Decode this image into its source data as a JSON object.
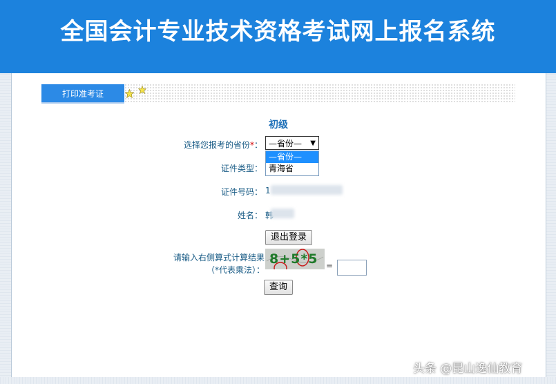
{
  "header": {
    "title": "全国会计专业技术资格考试网上报名系统"
  },
  "tab": {
    "label": "打印准考证"
  },
  "form": {
    "level_title": "初级",
    "province_label": "选择您报考的省份",
    "required_mark": "*",
    "colon": "：",
    "province_select": {
      "selected": "—省份—",
      "options": [
        "—省份—",
        "青海省"
      ]
    },
    "id_type_label": "证件类型：",
    "id_number_label": "证件号码：",
    "id_number_value_prefix": "1",
    "name_label": "姓名：",
    "name_value_prefix": "韩",
    "logout_button": "退出登录",
    "captcha_label_line1": "请输入右侧算式计算结果",
    "captcha_label_line2": "（*代表乘法）：",
    "captcha_text": "8+5*5",
    "equals": "=",
    "query_button": "查询"
  },
  "watermark": {
    "text": "头条 @昆山逸仙教育"
  },
  "colors": {
    "header_bg": "#1c82dd",
    "tab_bg": "#2c8ae6",
    "label": "#1a5c86",
    "required": "#d40000",
    "selected_option": "#1e90ff"
  }
}
